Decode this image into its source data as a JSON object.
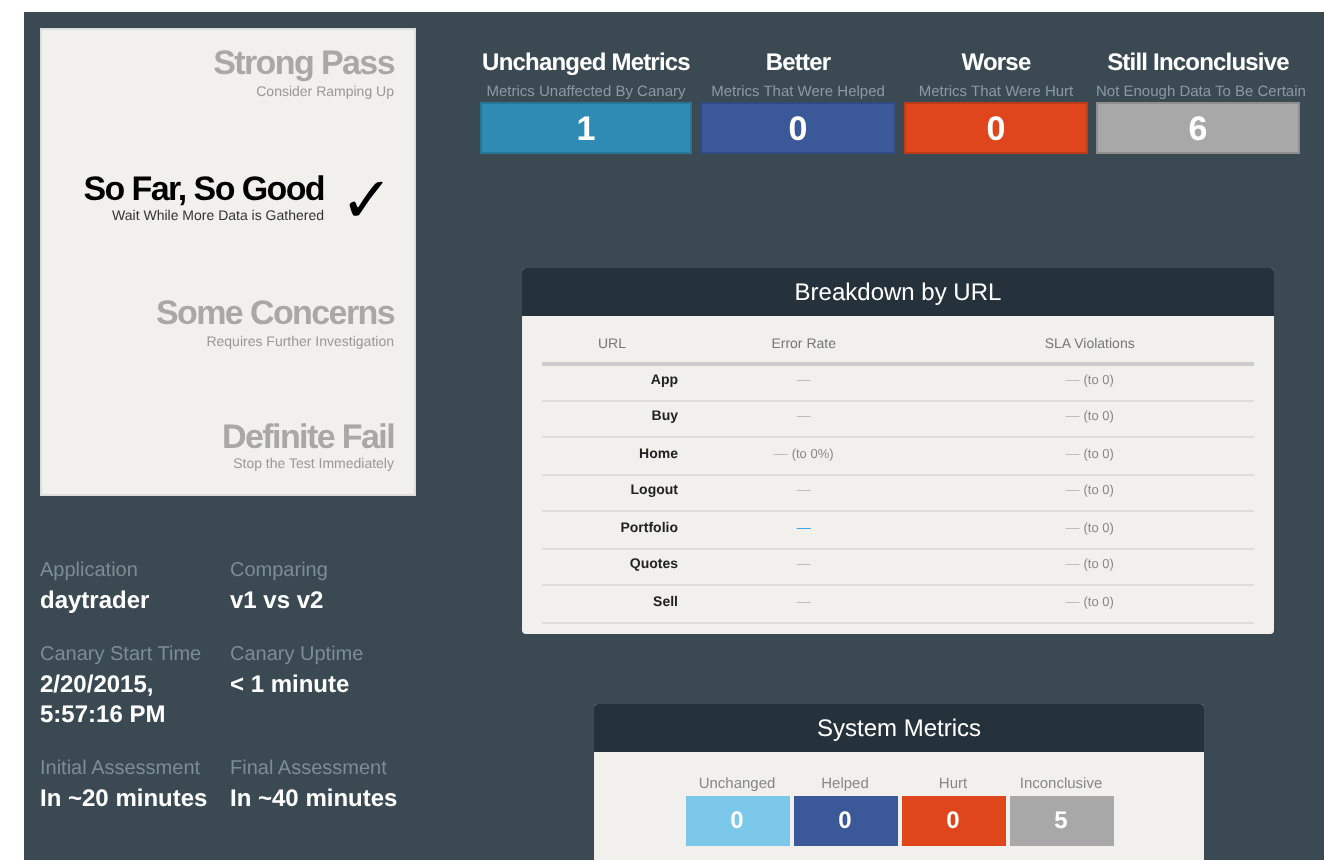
{
  "assessments": [
    {
      "title": "Strong Pass",
      "subtitle": "Consider Ramping Up",
      "selected": false
    },
    {
      "title": "So Far, So Good",
      "subtitle": "Wait While More Data is Gathered",
      "selected": true
    },
    {
      "title": "Some Concerns",
      "subtitle": "Requires Further Investigation",
      "selected": false
    },
    {
      "title": "Definite Fail",
      "subtitle": "Stop the Test Immediately",
      "selected": false
    }
  ],
  "check_mark": "✓",
  "info": [
    {
      "label": "Application",
      "value": "daytrader"
    },
    {
      "label": "Comparing",
      "value": "v1 vs v2"
    },
    {
      "label": "Canary Start Time",
      "value": "2/20/2015, 5:57:16 PM"
    },
    {
      "label": "Canary Uptime",
      "value": "< 1 minute"
    },
    {
      "label": "Initial Assessment",
      "value": "In ~20 minutes"
    },
    {
      "label": "Final Assessment",
      "value": "In ~40 minutes"
    }
  ],
  "metric_tiles": [
    {
      "title": "Unchanged Metrics",
      "subtitle": "Metrics Unaffected By Canary",
      "count": "1",
      "color": "#2e8bb3"
    },
    {
      "title": "Better",
      "subtitle": "Metrics That Were Helped",
      "count": "0",
      "color": "#3b5898"
    },
    {
      "title": "Worse",
      "subtitle": "Metrics That Were Hurt",
      "count": "0",
      "color": "#e0461c"
    },
    {
      "title": "Still Inconclusive",
      "subtitle": "Not Enough Data To Be Certain",
      "count": "6",
      "color": "#a8a8a8"
    }
  ],
  "breakdown": {
    "title": "Breakdown by URL",
    "columns": [
      "URL",
      "Error Rate",
      "SLA Violations"
    ],
    "rows": [
      {
        "url": "App",
        "error_rate": {
          "value": "—",
          "highlighted": false
        },
        "sla": {
          "value": "—",
          "note": "(to 0)"
        }
      },
      {
        "url": "Buy",
        "error_rate": {
          "value": "—",
          "highlighted": false
        },
        "sla": {
          "value": "—",
          "note": "(to 0)"
        }
      },
      {
        "url": "Home",
        "error_rate": {
          "value": "—",
          "note": "(to 0%)",
          "highlighted": false
        },
        "sla": {
          "value": "—",
          "note": "(to 0)"
        }
      },
      {
        "url": "Logout",
        "error_rate": {
          "value": "—",
          "highlighted": false
        },
        "sla": {
          "value": "—",
          "note": "(to 0)"
        }
      },
      {
        "url": "Portfolio",
        "error_rate": {
          "value": "—",
          "highlighted": true
        },
        "sla": {
          "value": "—",
          "note": "(to 0)"
        }
      },
      {
        "url": "Quotes",
        "error_rate": {
          "value": "—",
          "highlighted": false
        },
        "sla": {
          "value": "—",
          "note": "(to 0)"
        }
      },
      {
        "url": "Sell",
        "error_rate": {
          "value": "—",
          "highlighted": false
        },
        "sla": {
          "value": "—",
          "note": "(to 0)"
        }
      }
    ]
  },
  "system_metrics": {
    "title": "System Metrics",
    "tiles": [
      {
        "label": "Unchanged",
        "count": "0",
        "color": "#7cc8ea"
      },
      {
        "label": "Helped",
        "count": "0",
        "color": "#3b5898"
      },
      {
        "label": "Hurt",
        "count": "0",
        "color": "#e0461c"
      },
      {
        "label": "Inconclusive",
        "count": "5",
        "color": "#a8a8a8"
      }
    ]
  }
}
